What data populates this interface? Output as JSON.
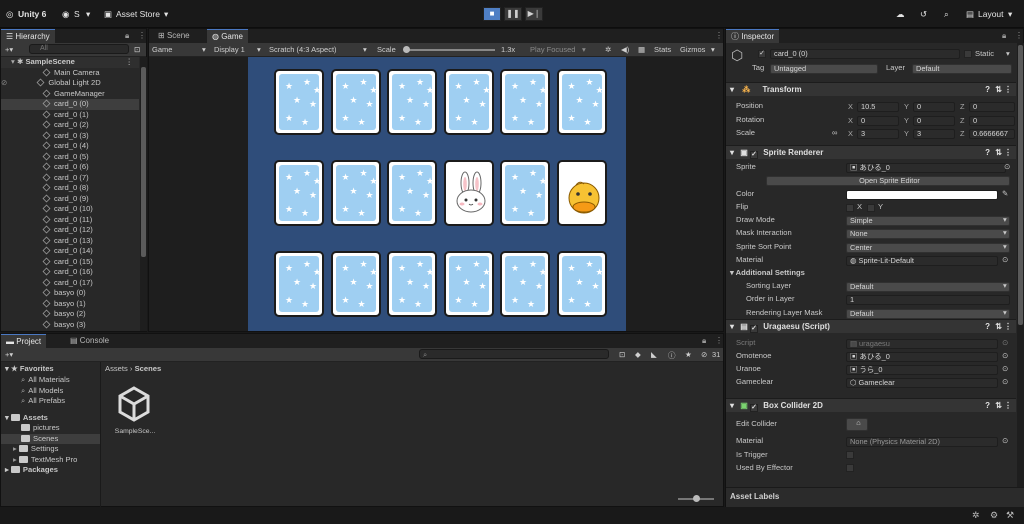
{
  "topbar": {
    "logo": "Unity 6",
    "account": "S",
    "asset_store": "Asset Store",
    "layout": "Layout"
  },
  "hierarchy": {
    "tab": "Hierarchy",
    "search_placeholder": "All",
    "scene": "SampleScene",
    "items": [
      "Main Camera",
      "Global Light 2D",
      "GameManager",
      "card_0 (0)",
      "card_0 (1)",
      "card_0 (2)",
      "card_0 (3)",
      "card_0 (4)",
      "card_0 (5)",
      "card_0 (6)",
      "card_0 (7)",
      "card_0 (8)",
      "card_0 (9)",
      "card_0 (10)",
      "card_0 (11)",
      "card_0 (12)",
      "card_0 (13)",
      "card_0 (14)",
      "card_0 (15)",
      "card_0 (16)",
      "card_0 (17)",
      "basyo (0)",
      "basyo (1)",
      "basyo (2)",
      "basyo (3)"
    ],
    "selected_index": 3
  },
  "game_view": {
    "tabs": [
      "Scene",
      "Game"
    ],
    "active_tab": "Game",
    "mode": "Game",
    "display": "Display 1",
    "aspect": "Scratch (4:3 Aspect)",
    "scale_label": "Scale",
    "scale_value": "1.3x",
    "play_focused": "Play Focused",
    "stats": "Stats",
    "gizmos": "Gizmos",
    "background_color": "#2f4d7a",
    "card_back_color": "#9fcff2",
    "cards": [
      "back",
      "back",
      "back",
      "back",
      "back",
      "back",
      "back",
      "back",
      "back",
      "rabbit",
      "back",
      "duck",
      "back",
      "back",
      "back",
      "back",
      "back",
      "back"
    ]
  },
  "project": {
    "tabs": [
      "Project",
      "Console"
    ],
    "favorites_label": "Favorites",
    "favorites": [
      "All Materials",
      "All Models",
      "All Prefabs"
    ],
    "assets_label": "Assets",
    "assets": [
      "pictures",
      "Scenes",
      "Settings",
      "TextMesh Pro"
    ],
    "packages_label": "Packages",
    "breadcrumb_root": "Assets",
    "breadcrumb_sep": "›",
    "breadcrumb_current": "Scenes",
    "file": "SampleSce...",
    "badge_count": "31"
  },
  "inspector": {
    "tab": "Inspector",
    "object_name": "card_0 (0)",
    "static_label": "Static",
    "tag_label": "Tag",
    "tag_value": "Untagged",
    "layer_label": "Layer",
    "layer_value": "Default",
    "transform": {
      "title": "Transform",
      "position_label": "Position",
      "position": [
        "10.5",
        "0",
        "0"
      ],
      "rotation_label": "Rotation",
      "rotation": [
        "0",
        "0",
        "0"
      ],
      "scale_label": "Scale",
      "scale": [
        "3",
        "3",
        "0.6666667"
      ]
    },
    "sprite_renderer": {
      "title": "Sprite Renderer",
      "sprite_label": "Sprite",
      "sprite_value": "あひる_0",
      "open_editor": "Open Sprite Editor",
      "color_label": "Color",
      "color_value": "#ffffff",
      "flip_label": "Flip",
      "flip_x": "X",
      "flip_y": "Y",
      "draw_mode_label": "Draw Mode",
      "draw_mode": "Simple",
      "mask_label": "Mask Interaction",
      "mask": "None",
      "sort_point_label": "Sprite Sort Point",
      "sort_point": "Center",
      "material_label": "Material",
      "material": "Sprite-Lit-Default",
      "additional": "Additional Settings",
      "sorting_layer_label": "Sorting Layer",
      "sorting_layer": "Default",
      "order_label": "Order in Layer",
      "order": "1",
      "mask_layer_label": "Rendering Layer Mask",
      "mask_layer": "Default"
    },
    "script": {
      "title": "Uragaesu (Script)",
      "script_label": "Script",
      "script_value": "uragaesu",
      "omotenoe_label": "Omotenoe",
      "omotenoe": "あひる_0",
      "uranoe_label": "Uranoe",
      "uranoe": "うら_0",
      "gameclear_label": "Gameclear",
      "gameclear": "Gameclear"
    },
    "collider": {
      "title": "Box Collider 2D",
      "edit_label": "Edit Collider",
      "material_label": "Material",
      "material": "None (Physics Material 2D)",
      "trigger_label": "Is Trigger",
      "effector_label": "Used By Effector"
    },
    "asset_labels": "Asset Labels"
  }
}
